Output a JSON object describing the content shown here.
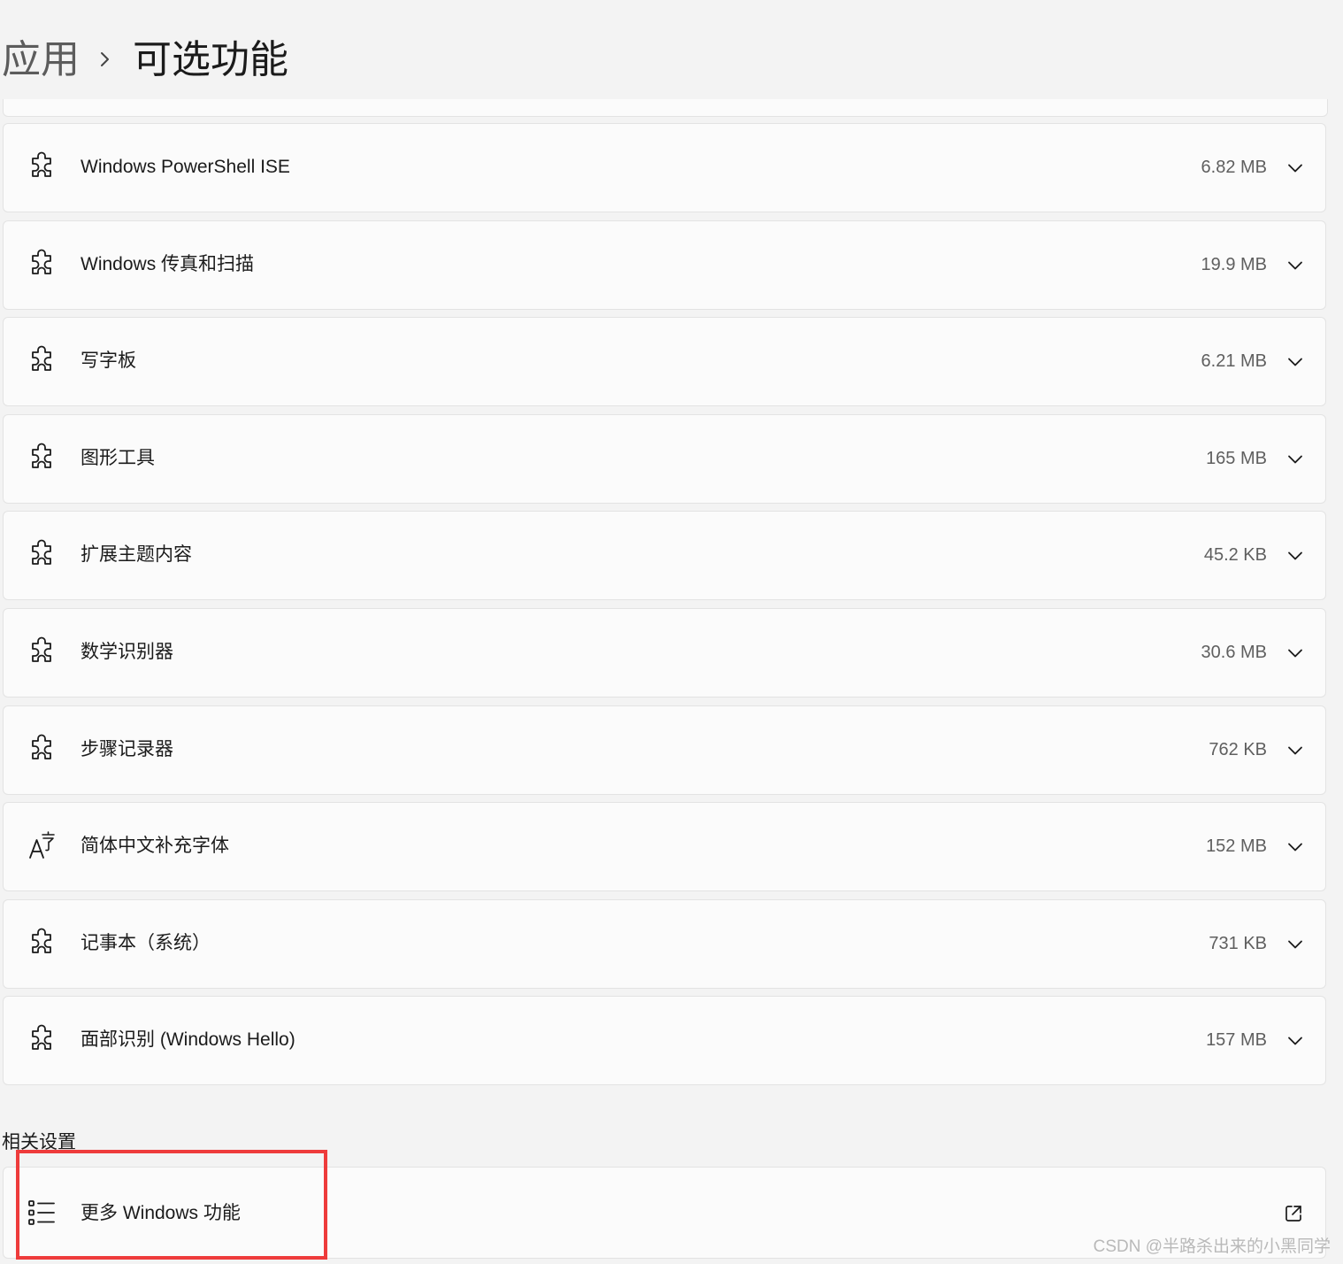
{
  "breadcrumb": {
    "parent": "应用",
    "current": "可选功能"
  },
  "features": [
    {
      "name": "Windows PowerShell ISE",
      "size": "6.82 MB",
      "icon": "puzzle-icon"
    },
    {
      "name": "Windows 传真和扫描",
      "size": "19.9 MB",
      "icon": "puzzle-icon"
    },
    {
      "name": "写字板",
      "size": "6.21 MB",
      "icon": "puzzle-icon"
    },
    {
      "name": "图形工具",
      "size": "165 MB",
      "icon": "puzzle-icon"
    },
    {
      "name": "扩展主题内容",
      "size": "45.2 KB",
      "icon": "puzzle-icon"
    },
    {
      "name": "数学识别器",
      "size": "30.6 MB",
      "icon": "puzzle-icon"
    },
    {
      "name": "步骤记录器",
      "size": "762 KB",
      "icon": "puzzle-icon"
    },
    {
      "name": "简体中文补充字体",
      "size": "152 MB",
      "icon": "font-icon"
    },
    {
      "name": "记事本（系统）",
      "size": "731 KB",
      "icon": "puzzle-icon"
    },
    {
      "name": "面部识别 (Windows Hello)",
      "size": "157 MB",
      "icon": "puzzle-icon"
    }
  ],
  "related": {
    "title": "相关设置",
    "more_features_label": "更多 Windows 功能",
    "icon": "list-icon",
    "action_icon": "open-external-icon"
  },
  "watermark": "CSDN @半路杀出来的小黑同学",
  "colors": {
    "background": "#f3f3f3",
    "card": "#fbfbfb",
    "card_border": "#e3e3e3",
    "highlight": "#ee3b3b"
  }
}
